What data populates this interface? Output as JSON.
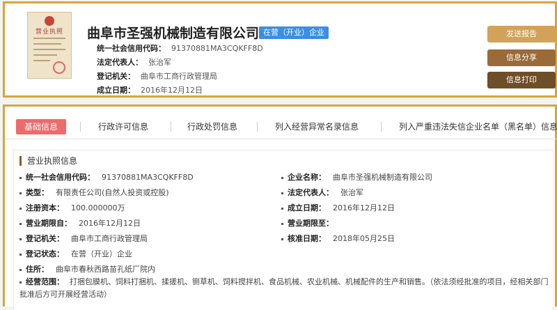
{
  "company": {
    "name": "曲阜市圣强机械制造有限公司",
    "status": "在营（开业）企业",
    "cert_title": "营业执照"
  },
  "summary": [
    {
      "label": "统一社会信用代码：",
      "value": "91370881MA3CQKFF8D"
    },
    {
      "label": "法定代表人：",
      "value": "张治军"
    },
    {
      "label": "登记机关：",
      "value": "曲阜市工商行政管理局"
    },
    {
      "label": "成立日期：",
      "value": "2016年12月12日"
    }
  ],
  "actions": {
    "report": "发送报告",
    "share": "信息分享",
    "print": "信息打印"
  },
  "tabs": [
    {
      "label": "基础信息",
      "active": true
    },
    {
      "label": "行政许可信息",
      "active": false
    },
    {
      "label": "行政处罚信息",
      "active": false
    },
    {
      "label": "列入经营异常名录信息",
      "active": false
    },
    {
      "label": "列入严重违法失信企业名单（黑名单）信息",
      "active": false
    }
  ],
  "license": {
    "title": "营业执照信息",
    "left": [
      {
        "label": "统一社会信用代码：",
        "value": "91370881MA3CQKFF8D"
      },
      {
        "label": "类型：",
        "value": "有限责任公司(自然人投资或控股)"
      },
      {
        "label": "注册资本：",
        "value": "100.000000万"
      },
      {
        "label": "营业期限自：",
        "value": "2016年12月12日"
      },
      {
        "label": "登记机关：",
        "value": "曲阜市工商行政管理局"
      },
      {
        "label": "登记状态：",
        "value": "在营（开业）企业"
      },
      {
        "label": "住所：",
        "value": "曲阜市春秋西路苗孔纸厂院内"
      }
    ],
    "right": [
      {
        "label": "企业名称：",
        "value": "曲阜市圣强机械制造有限公司"
      },
      {
        "label": "法定代表人：",
        "value": "张治军"
      },
      {
        "label": "成立日期：",
        "value": "2016年12月12日"
      },
      {
        "label": "营业期限至：",
        "value": ""
      },
      {
        "label": "核准日期：",
        "value": "2018年05月25日"
      }
    ],
    "scope_label": "经营范围：",
    "scope_value": "打捆包膜机、饲料打捆机、揉搓机、铡草机、饲料搅拌机、食品机械、农业机械、机械配件的生产和销售。（依法须经批准的项目，经相关部门批准后方可开展经营活动）"
  },
  "colors": {
    "border": "#d8a43a",
    "status_badge": "#3a8ee6",
    "active_tab": "#ee6b6b",
    "btn_report": "#d2a25a",
    "btn_share": "#9a6a38",
    "btn_print": "#6e4e29"
  }
}
